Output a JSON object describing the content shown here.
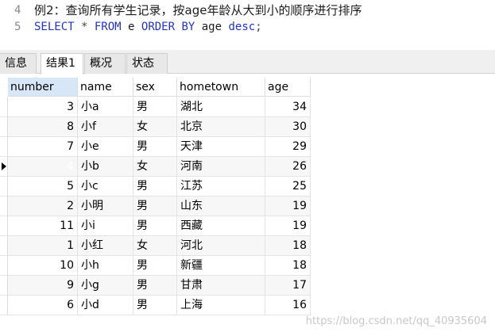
{
  "editor": {
    "lines": [
      {
        "no": "4",
        "text": "例2：查询所有学生记录，按age年龄从大到小的顺序进行排序"
      },
      {
        "no": "5",
        "tokens": [
          {
            "t": "SELECT",
            "c": "kw"
          },
          {
            "t": " * ",
            "c": "op"
          },
          {
            "t": "FROM",
            "c": "kw"
          },
          {
            "t": " e ",
            "c": "ident"
          },
          {
            "t": "ORDER BY",
            "c": "kw"
          },
          {
            "t": " age ",
            "c": "ident"
          },
          {
            "t": "desc",
            "c": "kw"
          },
          {
            "t": ";",
            "c": "op"
          }
        ]
      }
    ]
  },
  "tabs": [
    {
      "label": "信息",
      "active": false
    },
    {
      "label": "结果1",
      "active": true
    },
    {
      "label": "概况",
      "active": false
    },
    {
      "label": "状态",
      "active": false
    }
  ],
  "table": {
    "columns": [
      "number",
      "name",
      "sex",
      "hometown",
      "age"
    ],
    "selected_row": 3,
    "rows": [
      [
        "3",
        "小a",
        "男",
        "湖北",
        "34"
      ],
      [
        "8",
        "小f",
        "女",
        "北京",
        "30"
      ],
      [
        "7",
        "小e",
        "男",
        "天津",
        "29"
      ],
      [
        "4",
        "小b",
        "女",
        "河南",
        "26"
      ],
      [
        "5",
        "小c",
        "男",
        "江苏",
        "25"
      ],
      [
        "2",
        "小明",
        "男",
        "山东",
        "19"
      ],
      [
        "11",
        "小i",
        "男",
        "西藏",
        "19"
      ],
      [
        "1",
        "小红",
        "女",
        "河北",
        "18"
      ],
      [
        "10",
        "小h",
        "男",
        "新疆",
        "18"
      ],
      [
        "9",
        "小g",
        "男",
        "甘肃",
        "17"
      ],
      [
        "6",
        "小d",
        "男",
        "上海",
        "16"
      ]
    ]
  },
  "watermark": "https://blog.csdn.net/qq_40935604",
  "colors": {
    "selection": "#0f73d0",
    "keyword": "#2233cc"
  }
}
